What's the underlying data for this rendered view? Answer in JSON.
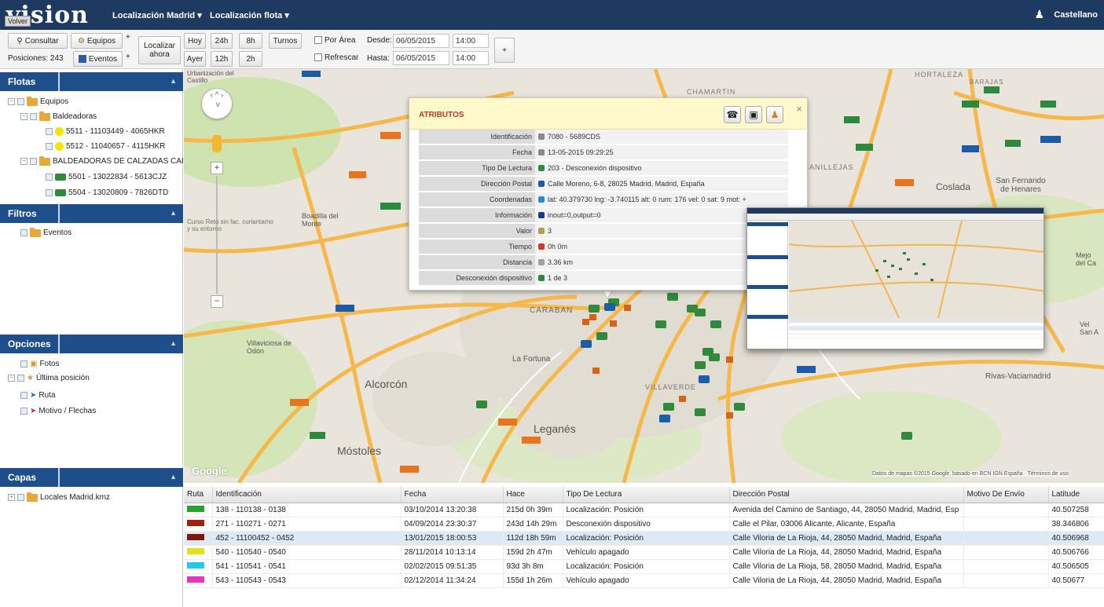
{
  "topbar": {
    "logo": "vision",
    "back": "Volver",
    "menu1": "Localización Madrid",
    "menu2": "Localización flota",
    "language": "Castellano",
    "colors": {
      "bar": "#1f3a60",
      "accent": "#1f4f8a"
    }
  },
  "toolbar": {
    "consultar": "Consultar",
    "equipos": "Equipos",
    "posiciones": "Posiciones: 243",
    "eventos": "Eventos",
    "localizar": "Localizar",
    "ahora": "ahora",
    "hoy": "Hoy",
    "ayer": "Ayer",
    "h24": "24h",
    "h12": "12h",
    "h8": "8h",
    "h2": "2h",
    "turnos": "Turnos",
    "por_area": "Por Área",
    "refrescar": "Refrescar",
    "desde_label": "Desde:",
    "hasta_label": "Hasta:",
    "desde_fecha": "06/05/2015",
    "desde_hora": "14:00",
    "hasta_fecha": "06/05/2015",
    "hasta_hora": "14:00",
    "plus": "+"
  },
  "left": {
    "flotas": {
      "title": "Flotas",
      "items": [
        "Equipos",
        "Baldeadoras",
        "5511 - 11103449 - 4065HKR",
        "5512 - 11040657 - 4115HKR",
        "BALDEADORAS DE CALZADAS CAI",
        "5501 - 13022834 - 5613CJZ",
        "5504 - 13020809 - 7826DTD"
      ]
    },
    "filtros": {
      "title": "Filtros",
      "items": [
        "Eventos"
      ]
    },
    "opciones": {
      "title": "Opciones",
      "items": [
        "Fotos",
        "Última posición",
        "Ruta",
        "Motivo / Flechas"
      ]
    },
    "capas": {
      "title": "Capas",
      "items": [
        "Locales Madrid.kmz"
      ]
    }
  },
  "map": {
    "labels": {
      "alcorcon": "Alcorcón",
      "leganes": "Leganés",
      "mostoles": "Móstoles",
      "coslada": "Coslada",
      "sanfernando": "San Fernando de Henares",
      "boadilla": "Boadilla del Monte",
      "fortuna": "La Fortuna",
      "caraban": "CARABAN",
      "villaverde": "VILLAVERDE",
      "hortaleza": "HORTALEZA",
      "canillejas": "AR-CANILLEJAS",
      "rivas": "Rivas-Vaciamadrid",
      "villaviciosa": "Villaviciosa de Odón",
      "google": "Google",
      "attribution": "Datos de mapas ©2015 Google, basado en BCN IGN España · Términos de uso",
      "castillo": "Urbanización del Castillo",
      "cursoagua": "Curso Reto sin fac. curlantamo y su entorno",
      "mejorada": "Mejo del Ca",
      "velilla": "Vel San A",
      "chamartin": "CHAMARTIN",
      "barajas": "BARAJAS"
    }
  },
  "popup": {
    "title": "ATRIBUTOS",
    "close": "×",
    "rows": [
      {
        "k": "Identificación",
        "v": "7080 - 5689CDS"
      },
      {
        "k": "Fecha",
        "v": "13-05-2015 09:29:25"
      },
      {
        "k": "Tipo De Lectura",
        "v": "203 - Desconexión dispositivo"
      },
      {
        "k": "Dirección Postal",
        "v": "Calle Moreno, 6-8, 28025 Madrid, Madrid, España"
      },
      {
        "k": "Coordenadas",
        "v": "lat: 40.379730 lng: -3.740115 alt: 0 rum: 176 vel: 0 sat: 9 mot: +"
      },
      {
        "k": "Información",
        "v": "inout=0,output=0"
      },
      {
        "k": "Valor",
        "v": "3"
      },
      {
        "k": "Tiempo",
        "v": "0h 0m"
      },
      {
        "k": "Distancia",
        "v": "3.36 km"
      },
      {
        "k": "Desconexión dispositivo",
        "v": "1 de 3"
      }
    ]
  },
  "table": {
    "headers": [
      "Ruta",
      "Identificación",
      "Fecha",
      "Hace",
      "Tipo De Lectura",
      "Dirección Postal",
      "Motivo De Envío",
      "Latitude"
    ],
    "rows": [
      {
        "color": "#27a02d",
        "id": "138 - 110138 - 0138",
        "fecha": "03/10/2014 13:20:38",
        "hace": "215d 0h 39m",
        "tipo": "Localización: Posición",
        "dir": "Avenida del Camino de Santiago, 44, 28050 Madrid, Madrid, Esp",
        "motivo": "",
        "lat": "40.507258"
      },
      {
        "color": "#a41e0e",
        "id": "271 - 110271 - 0271",
        "fecha": "04/09/2014 23:30:37",
        "hace": "243d 14h 29m",
        "tipo": "Desconexión dispositivo",
        "dir": "Calle el Pilar, 03006 Alicante, Alicante, España",
        "motivo": "",
        "lat": "38.346806"
      },
      {
        "color": "#7b1a0c",
        "id": "452 - 11100452 - 0452",
        "fecha": "13/01/2015 18:00:53",
        "hace": "112d 18h 59m",
        "tipo": "Localización: Posición",
        "dir": "Calle Viloria de La Rioja, 44, 28050 Madrid, Madrid, España",
        "motivo": "",
        "lat": "40.506968"
      },
      {
        "color": "#e5e01a",
        "id": "540 - 110540 - 0540",
        "fecha": "28/11/2014 10:13:14",
        "hace": "159d 2h 47m",
        "tipo": "Vehículo apagado",
        "dir": "Calle Viloria de La Rioja, 44, 28050 Madrid, Madrid, España",
        "motivo": "",
        "lat": "40.506766"
      },
      {
        "color": "#22c9e8",
        "id": "541 - 110541 - 0541",
        "fecha": "02/02/2015 09:51:35",
        "hace": "93d 3h 8m",
        "tipo": "Localización: Posición",
        "dir": "Calle Viloria de La Rioja, 58, 28050 Madrid, Madrid, España",
        "motivo": "",
        "lat": "40.506505"
      },
      {
        "color": "#e832c8",
        "id": "543 - 110543 - 0543",
        "fecha": "02/12/2014 11:34:24",
        "hace": "155d 1h 26m",
        "tipo": "Vehículo apagado",
        "dir": "Calle Viloria de La Rioja, 44, 28050 Madrid, Madrid, España",
        "motivo": "",
        "lat": "40.50677"
      }
    ]
  }
}
